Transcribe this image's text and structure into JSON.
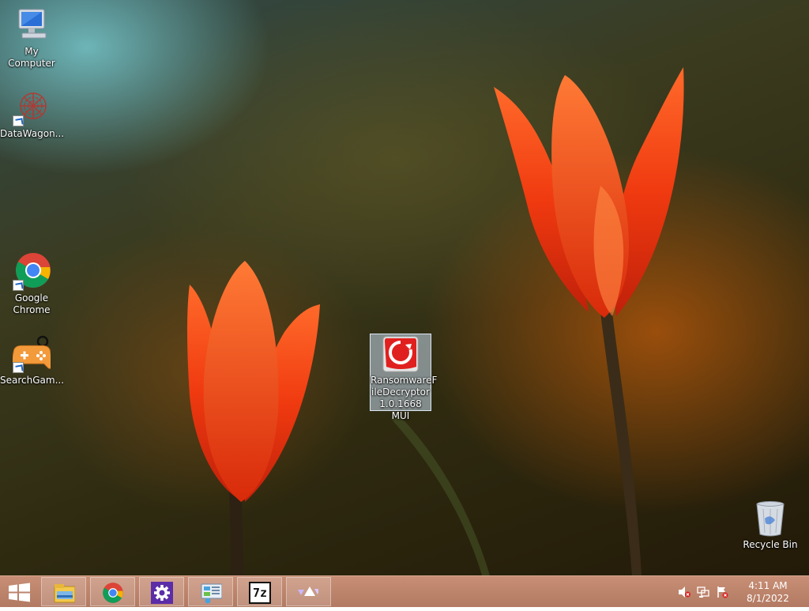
{
  "desktop": {
    "icons": [
      {
        "label": "My Computer",
        "icon": "computer-icon"
      },
      {
        "label": "DataWagon...",
        "icon": "datawagon-icon"
      },
      {
        "label": "Google\nChrome",
        "icon": "chrome-icon"
      },
      {
        "label": "SearchGam...",
        "icon": "gamepad-icon"
      },
      {
        "label": "RansomwareF\nileDecryptor\n1.0.1668 MUI",
        "icon": "trend-micro-icon"
      },
      {
        "label": "Recycle Bin",
        "icon": "recycle-bin-icon"
      }
    ]
  },
  "taskbar": {
    "start": {
      "icon": "windows-logo-icon"
    },
    "pinned": [
      {
        "icon": "file-explorer-icon"
      },
      {
        "icon": "chrome-icon"
      },
      {
        "icon": "settings-gear-icon"
      },
      {
        "icon": "control-panel-icon"
      },
      {
        "icon": "7zip-icon",
        "text": "7z"
      },
      {
        "icon": "triangles-app-icon"
      }
    ],
    "tray": {
      "icons": [
        "volume-muted-icon",
        "network-icon",
        "action-center-flag-icon"
      ],
      "time": "4:11 AM",
      "date": "8/1/2022"
    }
  },
  "colors": {
    "taskbar": "#b9806a",
    "accent_red": "#e0201e"
  }
}
